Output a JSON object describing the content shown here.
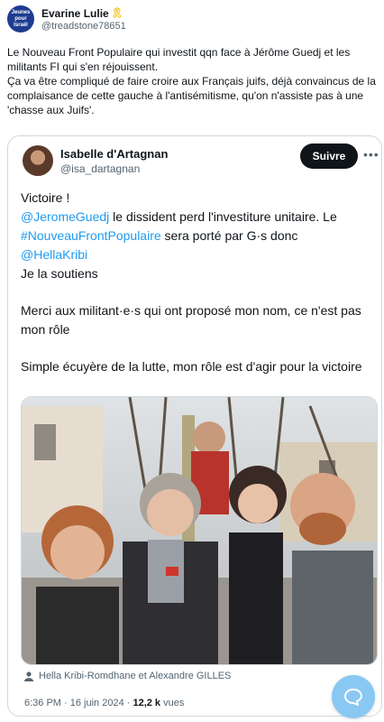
{
  "outer": {
    "avatar_text": "Jeunes pour Israël",
    "author_name": "Evarine Lulie",
    "badge_icon": "yellow-ribbon-icon",
    "handle": "@treadstone78651",
    "text_line1": "Le Nouveau Front Populaire qui investit qqn face à Jérôme Guedj et les militants FI qui s'en réjouissent.",
    "text_line2": "Ça va être compliqué de faire croire aux Français juifs, déjà convaincus de la complaisance de cette gauche à l'antisémitisme, qu'on n'assiste pas à une 'chasse aux Juifs'."
  },
  "quote": {
    "author_name": "Isabelle d'Artagnan",
    "handle": "@isa_dartagnan",
    "follow_label": "Suivre",
    "more_label": "•••",
    "line1": "Victoire !",
    "mention1": "@JeromeGuedj",
    "line2_rest": " le dissident perd l'investiture unitaire. Le",
    "hashtag": "#NouveauFrontPopulaire",
    "line3_rest": " sera porté par G·s donc",
    "mention2": "@HellaKribi",
    "line5": "Je la soutiens",
    "para2": "Merci aux militant·e·s qui ont proposé mon nom, ce n'est pas mon rôle",
    "para3": "Simple écuyère de la lutte, mon rôle est d'agir pour la victoire",
    "tagged": "Hella Kribi-Romdhane et Alexandre GILLES",
    "time": "6:36 PM · 16 juin 2024 · ",
    "views_count": "12,2 k",
    "views_label": " vues"
  },
  "colors": {
    "link": "#1d9bf0",
    "follow_bg": "#0f1419",
    "fab": "#89c8f2"
  },
  "icons": {
    "person": "person-icon",
    "more": "more-dots-icon",
    "fab": "message-bubble-icon"
  }
}
